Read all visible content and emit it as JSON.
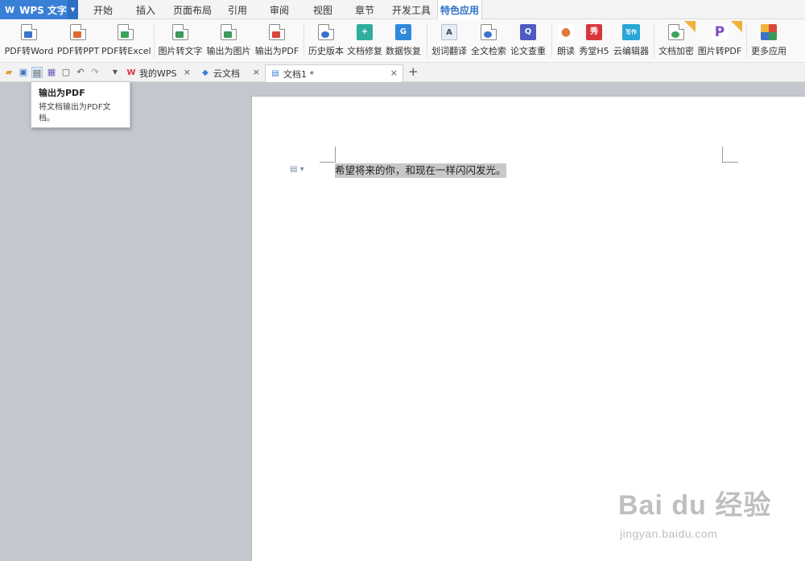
{
  "app": {
    "name": "WPS 文字",
    "logo": "W"
  },
  "menu": {
    "tabs": [
      "开始",
      "插入",
      "页面布局",
      "引用",
      "审阅",
      "视图",
      "章节",
      "开发工具",
      "特色应用"
    ],
    "active": "特色应用"
  },
  "ribbon": {
    "items": [
      {
        "label": "PDF转Word",
        "icon": "pdf-to-word-icon",
        "color": "#3c72c9"
      },
      {
        "label": "PDF转PPT",
        "icon": "pdf-to-ppt-icon",
        "color": "#e06a2f"
      },
      {
        "label": "PDF转Excel",
        "icon": "pdf-to-excel-icon",
        "color": "#3ca35b"
      },
      {
        "label": "图片转文字",
        "icon": "image-to-text-icon",
        "color": "#3c9a5a"
      },
      {
        "label": "输出为图片",
        "icon": "export-image-icon",
        "color": "#3c9a5a"
      },
      {
        "label": "输出为PDF",
        "icon": "export-pdf-icon",
        "color": "#d9473b"
      },
      {
        "label": "历史版本",
        "icon": "history-version-icon",
        "color": "#3c72c9"
      },
      {
        "label": "文档修复",
        "icon": "doc-repair-icon",
        "color": "#2fae9c"
      },
      {
        "label": "数据恢复",
        "icon": "data-recovery-icon",
        "color": "#2f88d8"
      },
      {
        "label": "划词翻译",
        "icon": "word-translate-icon",
        "color": "#5a6a8a"
      },
      {
        "label": "全文检索",
        "icon": "fulltext-search-icon",
        "color": "#3c72c9"
      },
      {
        "label": "论文查重",
        "icon": "paper-check-icon",
        "color": "#4e5bc2"
      },
      {
        "label": "朗读",
        "icon": "read-aloud-icon",
        "color": "#e07a3c"
      },
      {
        "label": "秀堂H5",
        "icon": "xiutang-h5-icon",
        "color": "#d9363b"
      },
      {
        "label": "云编辑器",
        "icon": "cloud-editor-icon",
        "color": "#27a6d8"
      },
      {
        "label": "文档加密",
        "icon": "doc-encrypt-icon",
        "color": "#3ca35b"
      },
      {
        "label": "图片转PDF",
        "icon": "image-to-pdf-icon",
        "color": "#7a4bc4"
      },
      {
        "label": "更多应用",
        "icon": "more-apps-icon",
        "color": "#d9473b"
      }
    ]
  },
  "quickbar": {
    "icons": [
      "open-folder-icon",
      "save-icon",
      "export-pdf-quick-icon",
      "print-icon",
      "print-preview-icon",
      "undo-icon",
      "redo-icon",
      "customize-dropdown-icon"
    ]
  },
  "tabs": [
    {
      "label": "我的WPS",
      "icon": "wps-logo-icon"
    },
    {
      "label": "云文档",
      "icon": "cloud-doc-icon"
    },
    {
      "label": "文档1 *",
      "icon": "document-icon",
      "active": true
    }
  ],
  "tooltip": {
    "title": "输出为PDF",
    "desc": "将文档输出为PDF文档。"
  },
  "document": {
    "text": "希望将来的你，和现在一样闪闪发光。"
  },
  "watermark": {
    "brand": "Bai du 经验",
    "url": "jingyan.baidu.com"
  },
  "colors": {
    "accent": "#3a7fd6",
    "active_tab_text": "#2f72c4",
    "canvas_bg": "#c4c7cd"
  }
}
